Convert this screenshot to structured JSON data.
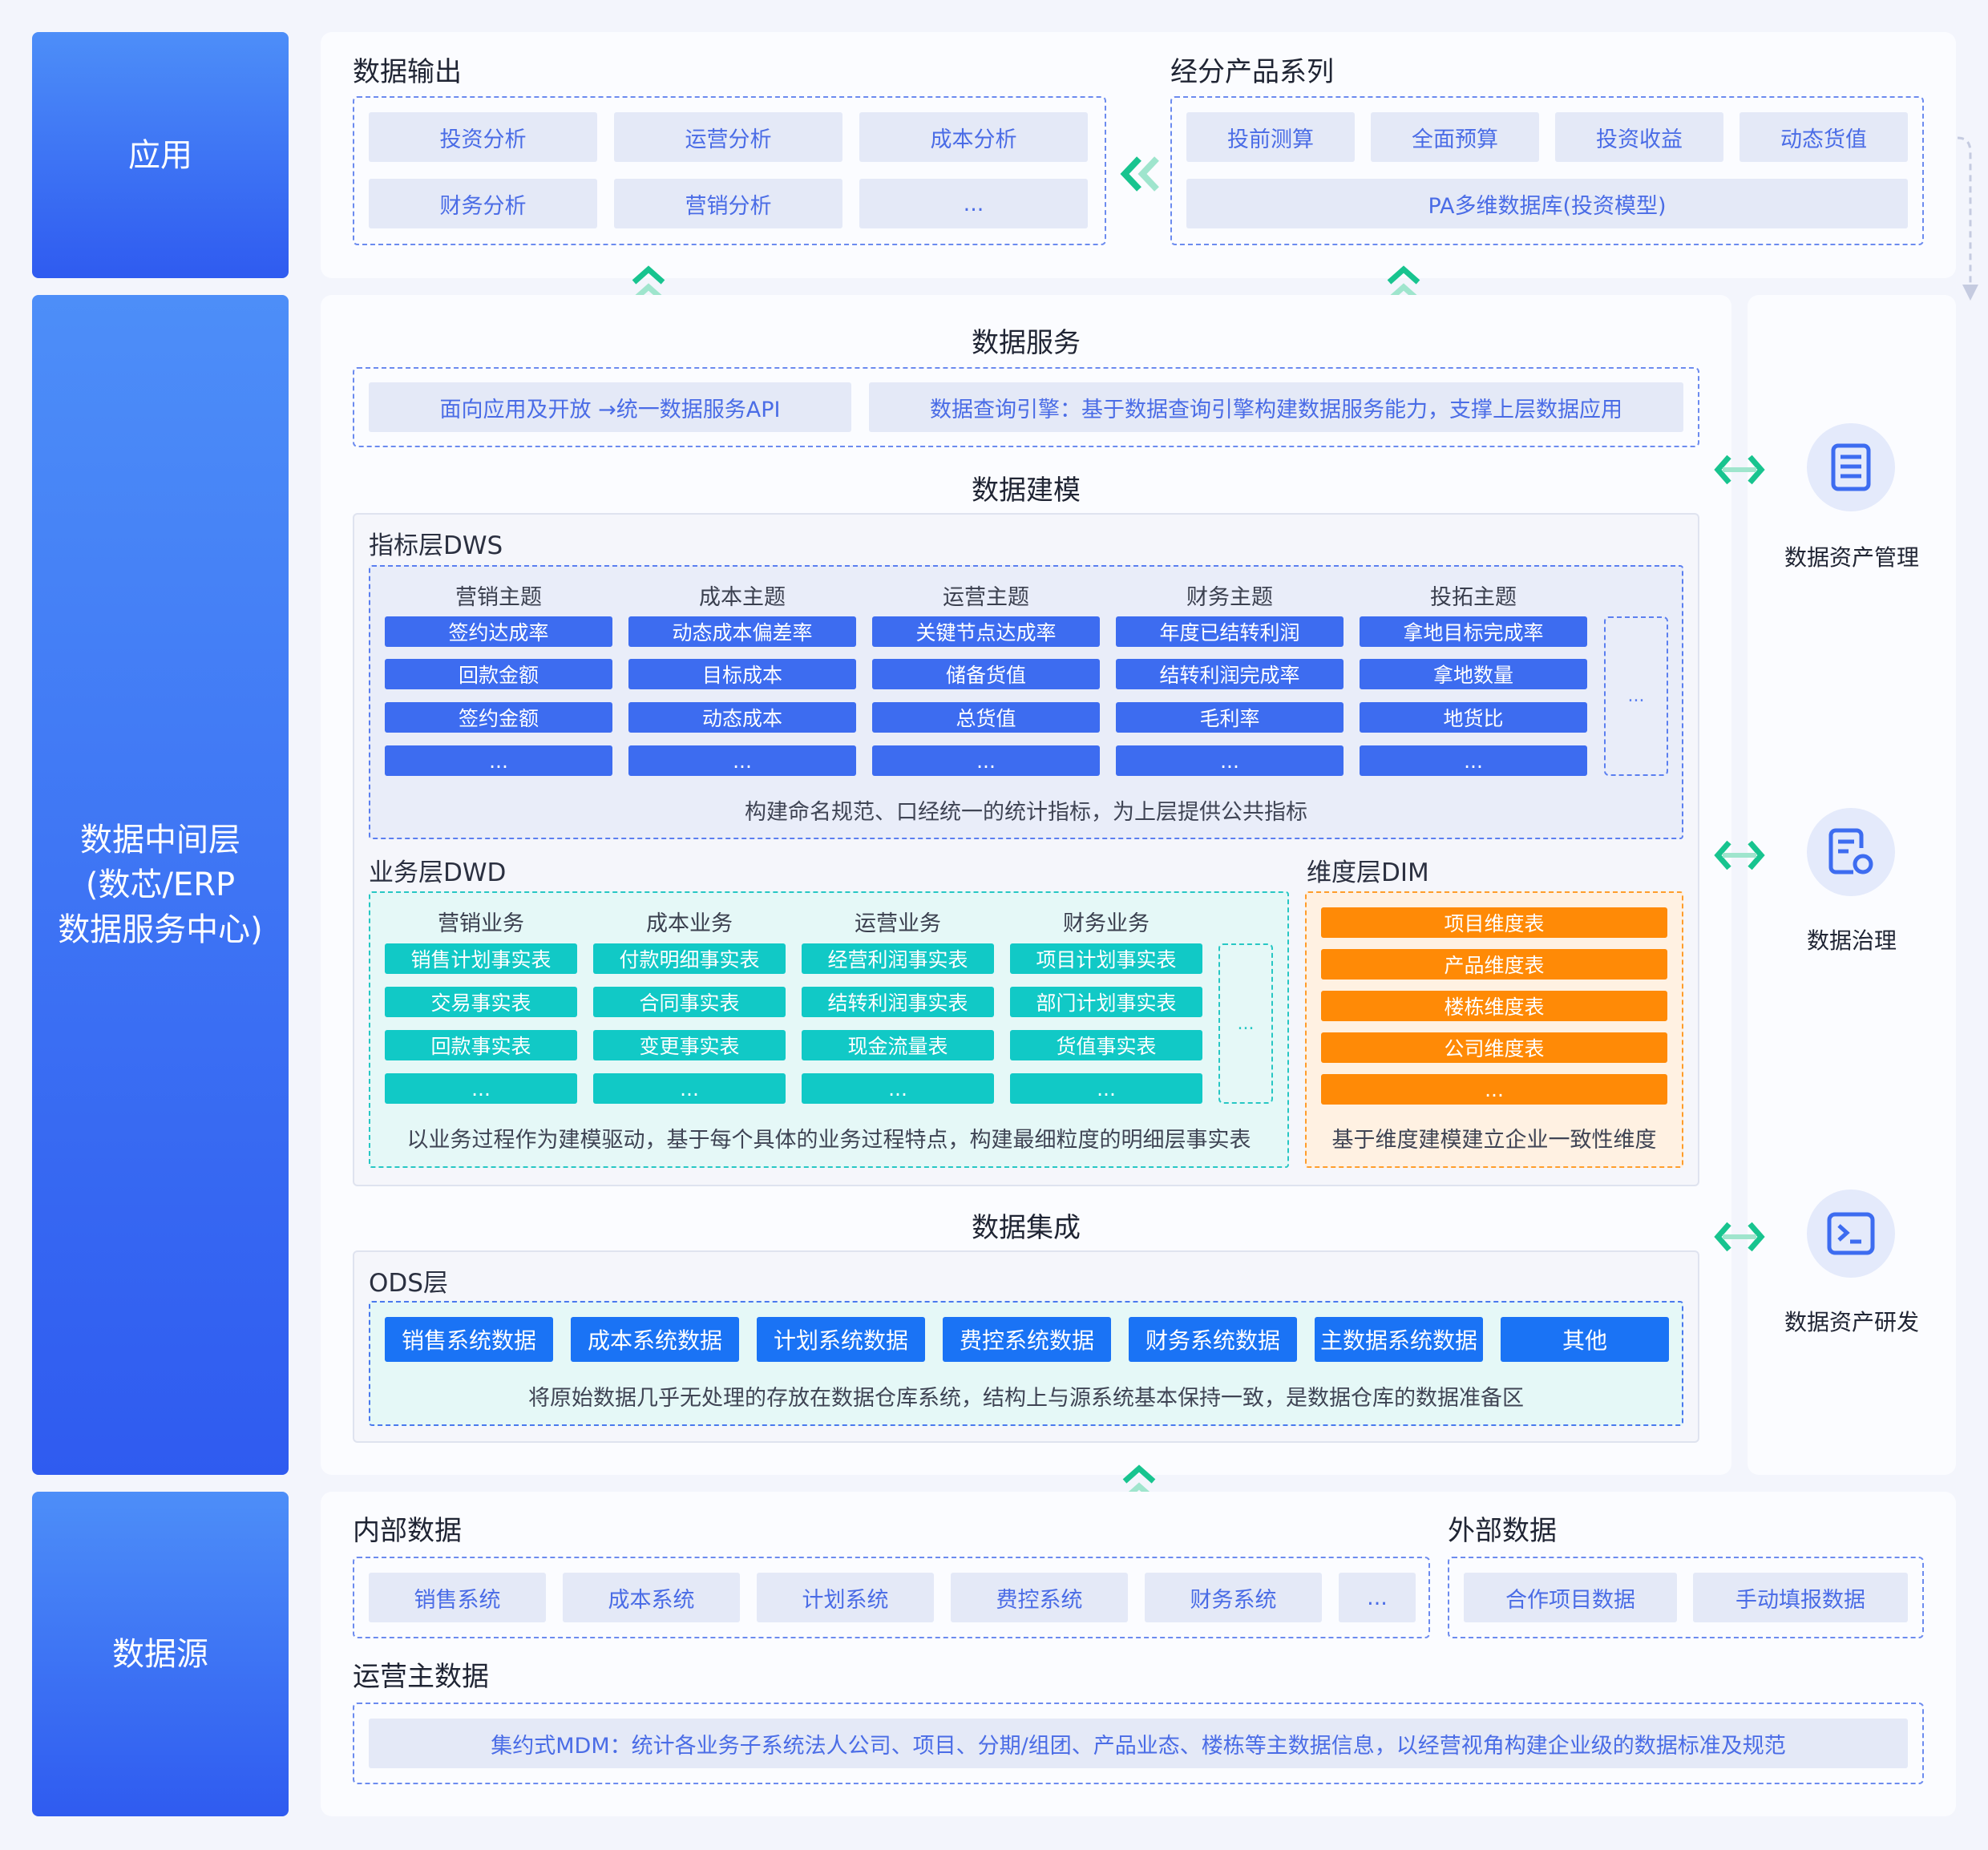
{
  "left_labels": {
    "app": "应用",
    "middle": "数据中间层\n(数芯/ERP\n数据服务中心)",
    "source": "数据源"
  },
  "top": {
    "data_output_title": "数据输出",
    "data_output_items": [
      "投资分析",
      "运营分析",
      "成本分析",
      "财务分析",
      "营销分析",
      "..."
    ],
    "product_series_title": "经分产品系列",
    "product_series_items": [
      "投前测算",
      "全面预算",
      "投资收益",
      "动态货值"
    ],
    "product_series_wide": "PA多维数据库(投资模型)"
  },
  "data_service": {
    "title": "数据服务",
    "items": [
      "面向应用及开放 →统一数据服务API",
      "数据查询引擎：基于数据查询引擎构建数据服务能力，支撑上层数据应用"
    ]
  },
  "data_modeling": {
    "title": "数据建模",
    "dws": {
      "label": "指标层DWS",
      "columns": [
        {
          "title": "营销主题",
          "items": [
            "签约达成率",
            "回款金额",
            "签约金额",
            "..."
          ]
        },
        {
          "title": "成本主题",
          "items": [
            "动态成本偏差率",
            "目标成本",
            "动态成本",
            "..."
          ]
        },
        {
          "title": "运营主题",
          "items": [
            "关键节点达成率",
            "储备货值",
            "总货值",
            "..."
          ]
        },
        {
          "title": "财务主题",
          "items": [
            "年度已结转利润",
            "结转利润完成率",
            "毛利率",
            "..."
          ]
        },
        {
          "title": "投拓主题",
          "items": [
            "拿地目标完成率",
            "拿地数量",
            "地货比",
            "..."
          ]
        }
      ],
      "more": "...",
      "note": "构建命名规范、口经统一的统计指标，为上层提供公共指标"
    },
    "dwd": {
      "label": "业务层DWD",
      "columns": [
        {
          "title": "营销业务",
          "items": [
            "销售计划事实表",
            "交易事实表",
            "回款事实表",
            "..."
          ]
        },
        {
          "title": "成本业务",
          "items": [
            "付款明细事实表",
            "合同事实表",
            "变更事实表",
            "..."
          ]
        },
        {
          "title": "运营业务",
          "items": [
            "经营利润事实表",
            "结转利润事实表",
            "现金流量表",
            "..."
          ]
        },
        {
          "title": "财务业务",
          "items": [
            "项目计划事实表",
            "部门计划事实表",
            "货值事实表",
            "..."
          ]
        }
      ],
      "more": "...",
      "note": "以业务过程作为建模驱动，基于每个具体的业务过程特点，构建最细粒度的明细层事实表"
    },
    "dim": {
      "label": "维度层DIM",
      "items": [
        "项目维度表",
        "产品维度表",
        "楼栋维度表",
        "公司维度表",
        "..."
      ],
      "note": "基于维度建模建立企业一致性维度"
    }
  },
  "data_integration": {
    "title": "数据集成",
    "ods_label": "ODS层",
    "items": [
      "销售系统数据",
      "成本系统数据",
      "计划系统数据",
      "费控系统数据",
      "财务系统数据",
      "主数据系统数据",
      "其他"
    ],
    "note": "将原始数据几乎无处理的存放在数据仓库系统，结构上与源系统基本保持一致，是数据仓库的数据准备区"
  },
  "right": {
    "items": [
      "数据资产管理",
      "数据治理",
      "数据资产研发"
    ],
    "icons": [
      "list-doc-icon",
      "doc-gear-icon",
      "terminal-icon"
    ]
  },
  "source": {
    "internal_title": "内部数据",
    "internal_items": [
      "销售系统",
      "成本系统",
      "计划系统",
      "费控系统",
      "财务系统",
      "..."
    ],
    "external_title": "外部数据",
    "external_items": [
      "合作项目数据",
      "手动填报数据"
    ],
    "ops_title": "运营主数据",
    "ops_item": "集约式MDM：统计各业务子系统法人公司、项目、分期/组团、产品业态、楼栋等主数据信息，以经营视角构建企业级的数据标准及规范"
  },
  "colors": {
    "primary": "#3d6cf0",
    "teal": "#11c9c6",
    "orange": "#ff8a06",
    "chip_bg": "#e4e9f7",
    "arrow_green": "#18c48f"
  }
}
